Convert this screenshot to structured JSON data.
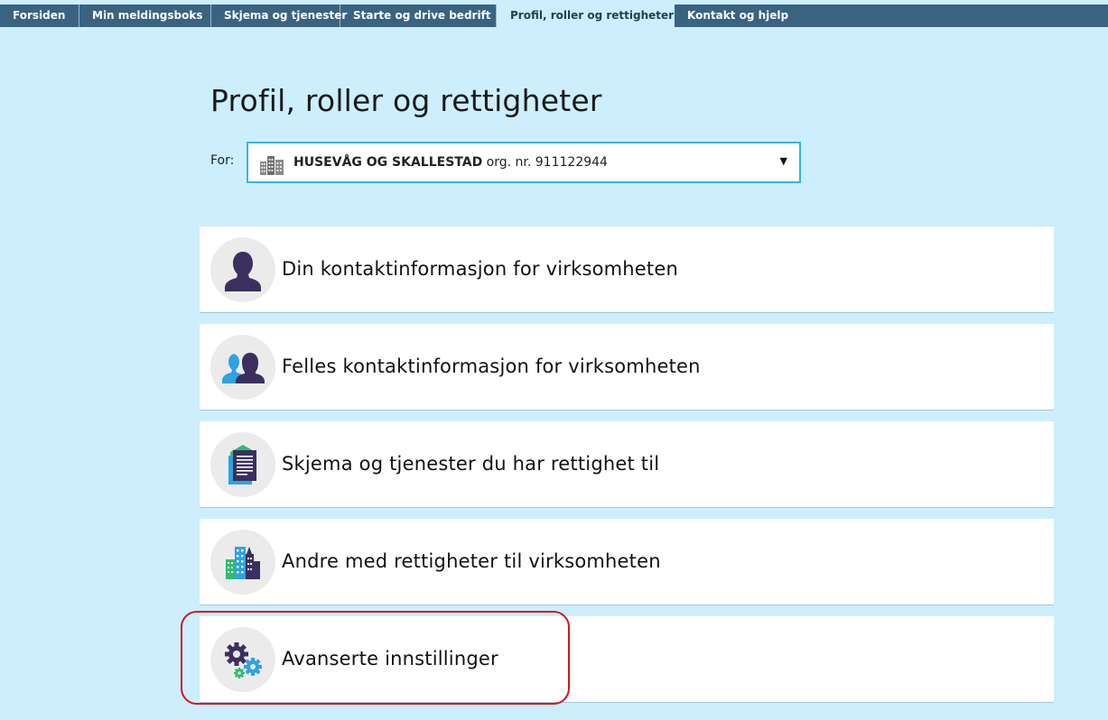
{
  "nav": {
    "tabs": [
      {
        "label": "Forsiden"
      },
      {
        "label": "Min meldingsboks"
      },
      {
        "label": "Skjema og tjenester"
      },
      {
        "label": "Starte og drive bedrift"
      },
      {
        "label": "Profil, roller og rettigheter"
      },
      {
        "label": "Kontakt og hjelp"
      }
    ],
    "active_index": 4
  },
  "page": {
    "title": "Profil, roller og rettigheter"
  },
  "org_selector": {
    "for_label": "For:",
    "name": "HUSEVÅG OG SKALLESTAD",
    "org_nr_text": "org. nr. 911122944",
    "icon": "building-icon"
  },
  "cards": [
    {
      "label": "Din kontaktinformasjon for virksomheten",
      "icon": "person-icon"
    },
    {
      "label": "Felles kontaktinformasjon for virksomheten",
      "icon": "people-icon"
    },
    {
      "label": "Skjema og tjenester du har rettighet til",
      "icon": "documents-icon"
    },
    {
      "label": "Andre med rettigheter til virksomheten",
      "icon": "buildings-icon"
    },
    {
      "label": "Avanserte innstillinger",
      "icon": "gears-icon"
    }
  ],
  "colors": {
    "nav_bg": "#3a6382",
    "page_bg": "#cdeefd",
    "select_border": "#35b4e2",
    "highlight": "#d4141c"
  }
}
